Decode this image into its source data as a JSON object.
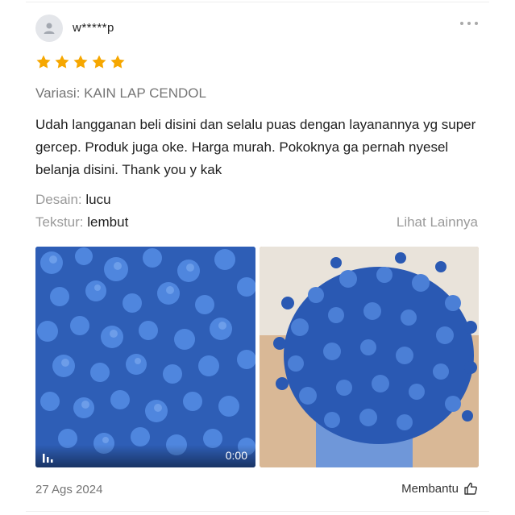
{
  "review": {
    "username": "w*****p",
    "rating": 5,
    "variant": "Variasi: KAIN LAP CENDOL",
    "text": "Udah langganan beli disini dan selalu puas dengan layanannya yg super gercep. Produk juga oke. Harga murah. Pokoknya ga pernah nyesel belanja disini. Thank you y kak",
    "attributes": [
      {
        "label": "Desain:",
        "value": "lucu"
      },
      {
        "label": "Tekstur:",
        "value": "lembut"
      }
    ],
    "see_more": "Lihat Lainnya",
    "media": [
      {
        "type": "video",
        "duration": "0:00"
      },
      {
        "type": "image"
      }
    ],
    "date": "27 Ags 2024",
    "helpful_label": "Membantu"
  },
  "colors": {
    "star": "#f6a700",
    "accent_blue": "#2f5fb8"
  },
  "icons": {
    "avatar": "user-icon",
    "more": "more-dots-icon",
    "video": "video-bars-icon",
    "helpful": "thumbs-up-icon"
  }
}
